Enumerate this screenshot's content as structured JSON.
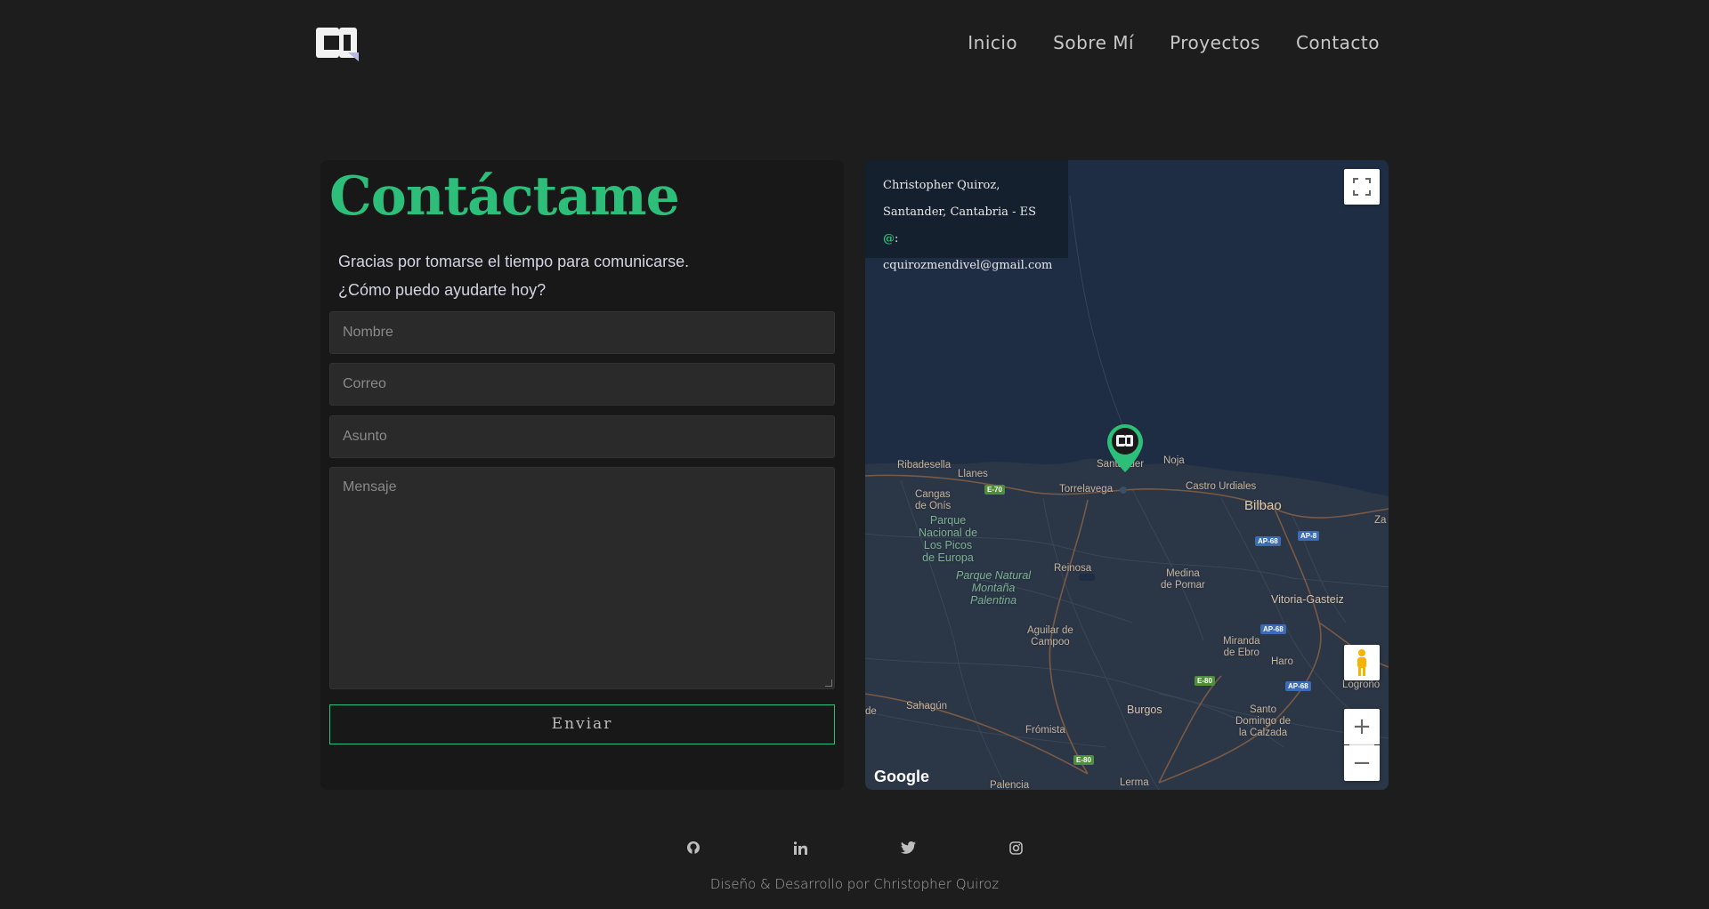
{
  "nav": {
    "items": [
      {
        "label": "Inicio"
      },
      {
        "label": "Sobre Mí"
      },
      {
        "label": "Proyectos"
      },
      {
        "label": "Contacto"
      }
    ]
  },
  "logo": {
    "text": "CQ"
  },
  "contact": {
    "title": "Contáctame",
    "intro_line1": "Gracias por tomarse el tiempo para comunicarse.",
    "intro_line2": "¿Cómo puedo ayudarte hoy?",
    "fields": {
      "name_placeholder": "Nombre",
      "email_placeholder": "Correo",
      "subject_placeholder": "Asunto",
      "message_placeholder": "Mensaje"
    },
    "submit_label": "Enviar"
  },
  "map": {
    "info_name": "Christopher Quiroz,",
    "info_location": "Santander, Cantabria - ES",
    "info_email_prefix": "@",
    "info_email": ": cquirozmendivel@gmail.com",
    "google_logo": "Google",
    "labels": {
      "ribadesella": "Ribadesella",
      "llanes": "Llanes",
      "santander": "Santander",
      "noja": "Noja",
      "torrelavega": "Torrelavega",
      "castro": "Castro Urdiales",
      "bilbao": "Bilbao",
      "cangas": "Cangas\nde Onís",
      "picos": "Parque\nNacional de\nLos Picos\nde Europa",
      "reinosa": "Reinosa",
      "medina": "Medina\nde Pomar",
      "montana": "Parque Natural\nMontaña\nPalentina",
      "vitoria": "Vitoria-Gasteiz",
      "aguilar": "Aguilar de\nCampoo",
      "miranda": "Miranda\nde Ebro",
      "haro": "Haro",
      "logrono": "Logroño",
      "sahagun": "Sahagún",
      "burgos": "Burgos",
      "santo": "Santo\nDomingo de\nla Calzada",
      "fromista": "Frómista",
      "palencia": "Palencia",
      "lerma": "Lerma",
      "za": "Za",
      "de": "de"
    },
    "shields": {
      "e70": "E-70",
      "ap68a": "AP-68",
      "ap8": "AP-8",
      "ap68b": "AP-68",
      "ap68c": "AP-68",
      "e80a": "E-80",
      "e80b": "E-80"
    },
    "zoom_in": "+",
    "zoom_out": "−"
  },
  "social": {
    "icons": [
      "github-icon",
      "linkedin-icon",
      "twitter-icon",
      "instagram-icon"
    ]
  },
  "footer": {
    "credit": "Diseño & Desarrollo por Christopher Quiroz"
  },
  "colors": {
    "background": "#1d1d1d",
    "accent": "#2dbf7a",
    "map_water": "#1f2d44",
    "map_land": "#2b3646"
  }
}
